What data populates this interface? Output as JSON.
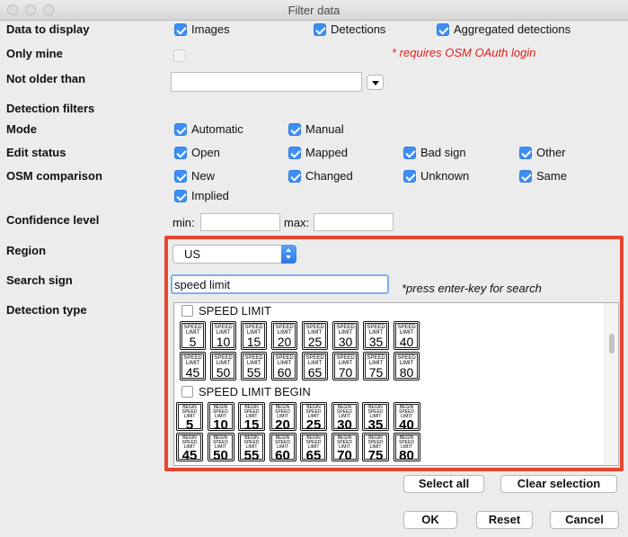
{
  "window": {
    "title": "Filter data"
  },
  "rows": {
    "display": {
      "label": "Data to display",
      "options": [
        "Images",
        "Detections",
        "Aggregated detections"
      ]
    },
    "only_mine": {
      "label": "Only mine",
      "note": "* requires OSM OAuth login"
    },
    "not_older": {
      "label": "Not older than"
    },
    "detection_filters": {
      "label": "Detection filters"
    },
    "mode": {
      "label": "Mode",
      "options": [
        "Automatic",
        "Manual"
      ]
    },
    "edit_status": {
      "label": "Edit status",
      "options": [
        "Open",
        "Mapped",
        "Bad sign",
        "Other"
      ]
    },
    "osm_comparison": {
      "label": "OSM comparison",
      "options": [
        "New",
        "Changed",
        "Unknown",
        "Same",
        "Implied"
      ]
    },
    "confidence": {
      "label": "Confidence level",
      "min_label": "min:",
      "max_label": "max:"
    },
    "region": {
      "label": "Region",
      "value": "US"
    },
    "search_sign": {
      "label": "Search sign",
      "value": "speed limit",
      "hint": "*press enter-key for search"
    },
    "detection_type": {
      "label": "Detection type"
    }
  },
  "sign_groups": [
    {
      "title": "SPEED LIMIT",
      "sign_text": "SPEED LIMIT",
      "values": [
        "5",
        "10",
        "15",
        "20",
        "25",
        "30",
        "35",
        "40",
        "45",
        "50",
        "55",
        "60",
        "65",
        "70",
        "75",
        "80"
      ]
    },
    {
      "title": "SPEED LIMIT BEGIN",
      "sign_text": "BEGIN SPEED LIMIT",
      "values": [
        "5",
        "10",
        "15",
        "20",
        "25",
        "30",
        "35",
        "40",
        "45",
        "50",
        "55",
        "60",
        "65",
        "70",
        "75",
        "80"
      ]
    }
  ],
  "buttons": {
    "select_all": "Select all",
    "clear_selection": "Clear selection",
    "ok": "OK",
    "reset": "Reset",
    "cancel": "Cancel"
  },
  "colors": {
    "accent": "#3d8ff5",
    "highlight": "#e8452f",
    "note": "#e02020"
  }
}
